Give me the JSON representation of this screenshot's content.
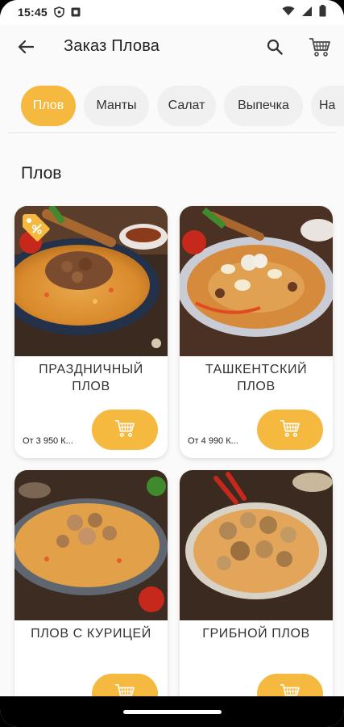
{
  "status_bar": {
    "time": "15:45",
    "icons": [
      "shield-icon",
      "notification-icon",
      "wifi-icon",
      "signal-icon",
      "battery-icon"
    ]
  },
  "app_bar": {
    "title": "Заказ Плова",
    "icons": [
      "back-arrow-icon",
      "search-icon",
      "cart-icon"
    ]
  },
  "categories": [
    {
      "label": "Плов",
      "active": true
    },
    {
      "label": "Манты",
      "active": false
    },
    {
      "label": "Салат",
      "active": false
    },
    {
      "label": "Выпечка",
      "active": false
    },
    {
      "label": "На",
      "active": false
    }
  ],
  "section": {
    "title": "Плов"
  },
  "products": [
    {
      "name": "ПРАЗДНИЧНЫЙ ПЛОВ",
      "price": "От 3 950 К...",
      "has_discount": true
    },
    {
      "name": "ТАШКЕНТСКИЙ ПЛОВ",
      "price": "От 4 990 К...",
      "has_discount": false
    },
    {
      "name": "ПЛОВ С КУРИЦЕЙ",
      "price": "",
      "has_discount": false
    },
    {
      "name": "ГРИБНОЙ ПЛОВ",
      "price": "",
      "has_discount": false
    }
  ],
  "colors": {
    "accent": "#f5b93f",
    "chip_bg": "#f0f0f0",
    "background": "#fafafa",
    "text": "#222222"
  }
}
